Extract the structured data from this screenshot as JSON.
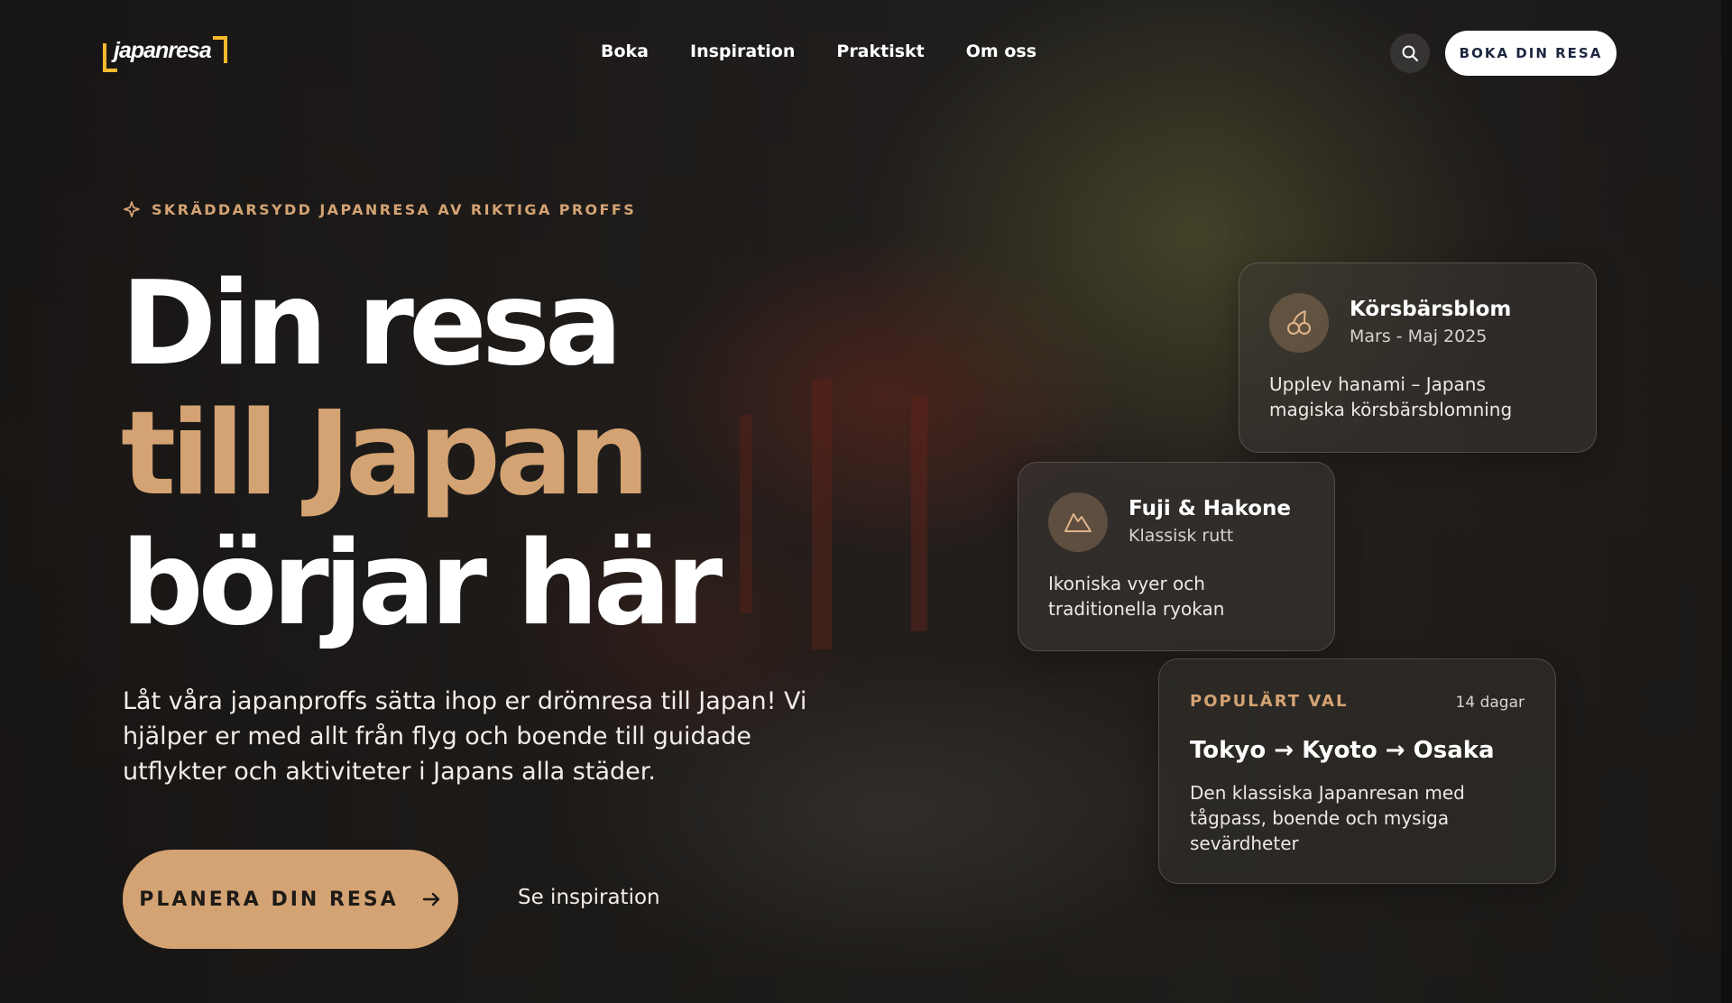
{
  "logo": {
    "text": "japanresa"
  },
  "nav": {
    "items": [
      "Boka",
      "Inspiration",
      "Praktiskt",
      "Om oss"
    ]
  },
  "header": {
    "cta_label": "BOKA DIN RESA",
    "search_icon": "search-icon"
  },
  "hero": {
    "eyebrow": "SKRÄDDARSYDD JAPANRESA AV RIKTIGA PROFFS",
    "headline_line1": "Din resa",
    "headline_line2": "till Japan",
    "headline_line3": "börjar här",
    "lead": "Låt våra japanproffs sätta ihop er drömresa till Japan! Vi hjälper er med allt från flyg och boende till guidade utflykter och aktiviteter i Japans alla städer.",
    "primary_cta": "PLANERA DIN RESA",
    "secondary_cta": "Se inspiration"
  },
  "cards": [
    {
      "icon": "cherry-icon",
      "title": "Körsbärsblom",
      "subtitle": "Mars - Maj 2025",
      "description": "Upplev hanami – Japans magiska körsbärsblomning"
    },
    {
      "icon": "mountain-icon",
      "title": "Fuji & Hakone",
      "subtitle": "Klassisk rutt",
      "description": "Ikoniska vyer och traditionella ryokan"
    },
    {
      "tag": "POPULÄRT VAL",
      "duration": "14 dagar",
      "title": "Tokyo → Kyoto → Osaka",
      "description": "Den klassiska Japanresan med tågpass, boende och mysiga sevärdheter"
    }
  ],
  "colors": {
    "accent": "#d4a373",
    "logo_yellow": "#f5b82e",
    "cta_text": "#1c2740"
  }
}
